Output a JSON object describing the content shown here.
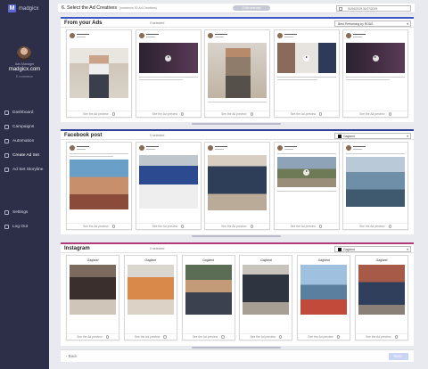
{
  "app": {
    "logo_text": "madgicx"
  },
  "user": {
    "role": "Ads Manager",
    "name": "madgicx.com",
    "sub": "E-commerce"
  },
  "nav": {
    "items": [
      {
        "label": "Dashboard",
        "icon": "bar-chart-icon"
      },
      {
        "label": "Campaigns",
        "icon": "megaphone-icon"
      },
      {
        "label": "Automation",
        "icon": "gear-icon"
      },
      {
        "label": "Create Ad Set",
        "icon": "edit-icon"
      },
      {
        "label": "Ad Set Storyline",
        "icon": "storyline-icon"
      }
    ],
    "bottom": [
      {
        "label": "Settings",
        "icon": "settings-icon"
      },
      {
        "label": "Log Out",
        "icon": "logout-icon"
      }
    ]
  },
  "header": {
    "title": "6. Select the Ad Creatives",
    "hint": "(maximum 30 Ad Creatives)",
    "selected_pill": "0 Ads selected",
    "date_range": "01/06/2019-31/07/2019"
  },
  "sections": {
    "your_ads": {
      "title": "From your Ads",
      "count": "0 selected",
      "select": "Best Performing by ROAS",
      "accent": "#3a56c4",
      "preview_label": "See the Ad preview",
      "cards": 5
    },
    "facebook": {
      "title": "Facebook post",
      "count": "0 selected",
      "select": "Gagland",
      "accent": "#2c3e95",
      "preview_label": "See the Ad preview",
      "cards": 5
    },
    "instagram": {
      "title": "Instagram",
      "count": "0 selected",
      "select": "Gagland",
      "accent": "#b03a7a",
      "preview_label": "See the Ad preview",
      "account_label": "Gagland",
      "cards": 6
    }
  },
  "footer": {
    "back": "Back",
    "next": "Next"
  }
}
